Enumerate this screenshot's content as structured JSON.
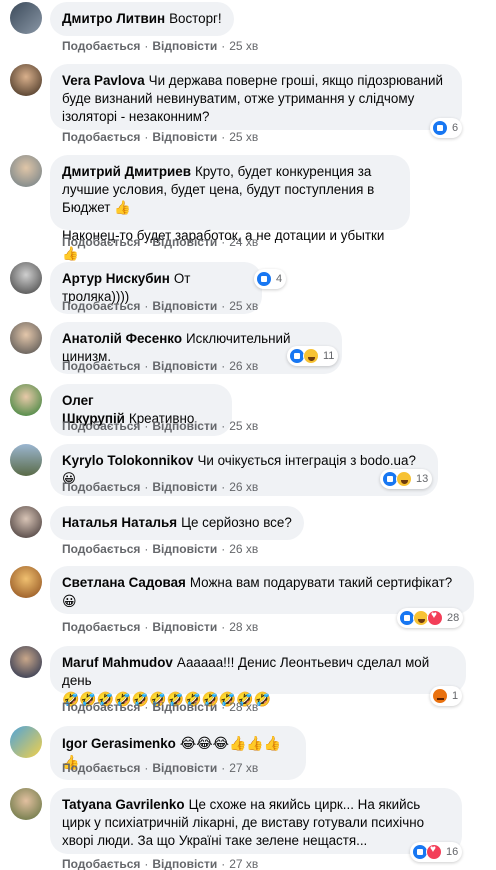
{
  "labels": {
    "like": "Подобається",
    "reply": "Відповісти"
  },
  "comments": [
    {
      "name": "Дмитро Литвин",
      "text": "Восторг!",
      "time": "25 хв"
    },
    {
      "name": "Vera Pavlova",
      "text": "Чи держава поверне гроші, якщо підозрюваний буде визнаний невинуватим, отже утримання у слідчому ізоляторі - незаконним?",
      "time": "25 хв",
      "reactions": {
        "icons": [
          "like"
        ],
        "count": "6"
      }
    },
    {
      "name": "Дмитрий Дмитриев",
      "text": "Круто, будет конкуренция за лучшие условия, будет цена, будут поступления в Бюджет 👍",
      "text2": "Наконец-то будет заработок, а не дотации и убытки 👍",
      "time": "24 хв"
    },
    {
      "name": "Артур Нискубин",
      "text": "От троляка))))",
      "time": "25 хв",
      "reactions": {
        "icons": [
          "like"
        ],
        "count": "4"
      }
    },
    {
      "name": "Анатолій Фесенко",
      "text": "Исключительний цинизм.",
      "time": "26 хв",
      "reactions": {
        "icons": [
          "like",
          "haha"
        ],
        "count": "11"
      }
    },
    {
      "name": "Олег Шкурупій",
      "text": "Креативно",
      "time": "25 хв"
    },
    {
      "name": "Kyrylo Tolokonnikov",
      "text": "Чи очікується інтеграція з bodo.ua? 😀",
      "time": "26 хв",
      "reactions": {
        "icons": [
          "like",
          "haha"
        ],
        "count": "13"
      }
    },
    {
      "name": "Наталья Наталья",
      "text": "Це серйозно все?",
      "time": "26 хв"
    },
    {
      "name": "Светлана Садовая",
      "text": "Можна вам подарувати такий сертифікат?",
      "text2": "😀",
      "time": "28 хв",
      "reactions": {
        "icons": [
          "like",
          "haha",
          "love"
        ],
        "count": "28"
      }
    },
    {
      "name": "Maruf Mahmudov",
      "text": "Аааааа!!! Денис Леонтьевич сделал мой день",
      "text2": "🤣🤣🤣🤣🤣🤣🤣🤣🤣🤣🤣🤣",
      "time": "28 хв",
      "reactions": {
        "icons": [
          "angry"
        ],
        "count": "1"
      }
    },
    {
      "name": "Igor Gerasimenko",
      "text": "😂😂😂👍👍👍👍",
      "time": "27 хв"
    },
    {
      "name": "Tatyana Gavrilenko",
      "text": "Це схоже на якийсь цирк... На якийсь цирк у психіатричній лікарні, де виставу готували психічно хворі люди. За що Україні таке зелене нещастя...",
      "time": "27 хв",
      "reactions": {
        "icons": [
          "like",
          "love"
        ],
        "count": "16"
      }
    }
  ],
  "colors": {
    "bubble": "#f0f2f5",
    "meta": "#65676b",
    "like": "#1877f2",
    "haha": "#f7c233",
    "love": "#f33e58",
    "angry": "#e9710f"
  }
}
